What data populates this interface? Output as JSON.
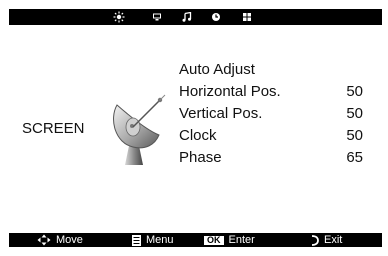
{
  "tabs": [
    {
      "icon": "picture-sun-icon"
    },
    {
      "icon": "screen-monitor-icon"
    },
    {
      "icon": "sound-note-icon"
    },
    {
      "icon": "timer-clock-icon"
    },
    {
      "icon": "setup-grid-icon"
    }
  ],
  "section": {
    "title": "SCREEN",
    "illustration_icon": "satellite-dish-icon"
  },
  "menu": {
    "items": [
      {
        "label": "Auto Adjust",
        "value": ""
      },
      {
        "label": "Horizontal Pos.",
        "value": "50"
      },
      {
        "label": "Vertical Pos.",
        "value": "50"
      },
      {
        "label": "Clock",
        "value": "50"
      },
      {
        "label": "Phase",
        "value": "65"
      }
    ]
  },
  "hints": {
    "move": "Move",
    "menu": "Menu",
    "ok_badge": "OK",
    "enter": "Enter",
    "exit": "Exit"
  }
}
